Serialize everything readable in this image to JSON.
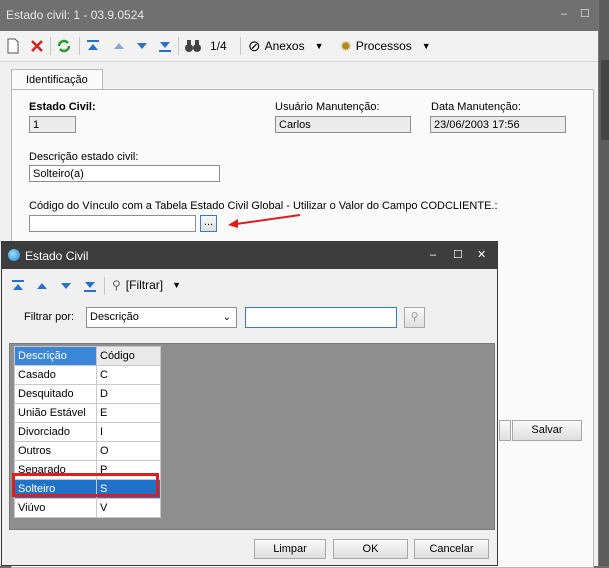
{
  "window": {
    "title": "Estado civil: 1 - 03.9.0524",
    "controls": {
      "minimize": "–",
      "maximize": "☐",
      "close": "✕"
    }
  },
  "toolbar": {
    "record_counter": "1/4",
    "anexos_label": "Anexos",
    "processos_label": "Processos"
  },
  "tabs": [
    {
      "label": "Identificação"
    }
  ],
  "form": {
    "estado_civil_label": "Estado Civil:",
    "estado_civil_value": "1",
    "usuario_label": "Usuário Manutenção:",
    "usuario_value": "Carlos",
    "data_label": "Data Manutenção:",
    "data_value": "23/06/2003 17:56",
    "descricao_label": "Descrição estado civil:",
    "descricao_value": "Solteiro(a)",
    "codigo_label": "Código do Vínculo com a Tabela Estado Civil Global - Utilizar o Valor do Campo CODCLIENTE.:",
    "codigo_value": "",
    "lookup_button": "..."
  },
  "buttons": {
    "salvar": "Salvar"
  },
  "dialog": {
    "title": "Estado Civil",
    "filtrar_label": "[Filtrar]",
    "filtrar_por_label": "Filtrar por:",
    "filtrar_por_value": "Descrição",
    "filter_value": "",
    "columns": [
      "Descrição",
      "Código"
    ],
    "rows": [
      {
        "descricao": "Casado",
        "codigo": "C"
      },
      {
        "descricao": "Desquitado",
        "codigo": "D"
      },
      {
        "descricao": "União Estável",
        "codigo": "E"
      },
      {
        "descricao": "Divorciado",
        "codigo": "I"
      },
      {
        "descricao": "Outros",
        "codigo": "O"
      },
      {
        "descricao": "Separado",
        "codigo": "P"
      },
      {
        "descricao": "Solteiro",
        "codigo": "S"
      },
      {
        "descricao": "Viúvo",
        "codigo": "V"
      }
    ],
    "selected_row": "Solteiro",
    "buttons": {
      "limpar": "Limpar",
      "ok": "OK",
      "cancelar": "Cancelar"
    },
    "controls": {
      "minimize": "–",
      "maximize": "☐",
      "close": "✕"
    }
  },
  "colors": {
    "highlight": "#e01d1d",
    "selection": "#1e73c9",
    "annotation_arrow": "#e01d1d"
  }
}
